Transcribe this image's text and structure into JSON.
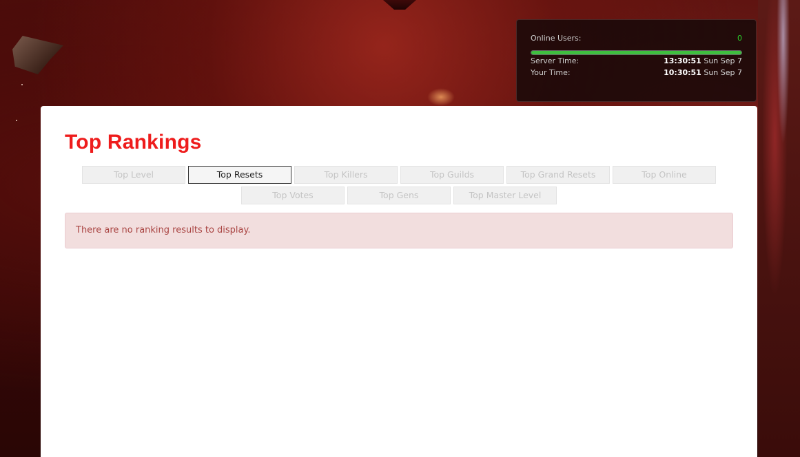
{
  "server_info": {
    "online_users_label": "Online Users:",
    "online_users_count": "0",
    "online_users_fill": 1.0,
    "server_time_label": "Server Time:",
    "server_time_clock": "13:30:51",
    "server_time_date": "Sun Sep 7",
    "your_time_label": "Your Time:",
    "your_time_clock": "10:30:51",
    "your_time_date": "Sun Sep 7",
    "colors": {
      "online_count": "#2bd12b",
      "bar_fill": "#3fbf3f"
    }
  },
  "page": {
    "title": "Top Rankings",
    "title_color": "#ee1c1c"
  },
  "tabs": [
    {
      "label": "Top Level",
      "active": false
    },
    {
      "label": "Top Resets",
      "active": true
    },
    {
      "label": "Top Killers",
      "active": false
    },
    {
      "label": "Top Guilds",
      "active": false
    },
    {
      "label": "Top Grand Resets",
      "active": false
    },
    {
      "label": "Top Online",
      "active": false
    },
    {
      "label": "Top Votes",
      "active": false
    },
    {
      "label": "Top Gens",
      "active": false
    },
    {
      "label": "Top Master Level",
      "active": false
    }
  ],
  "alert": {
    "message": "There are no ranking results to display."
  }
}
